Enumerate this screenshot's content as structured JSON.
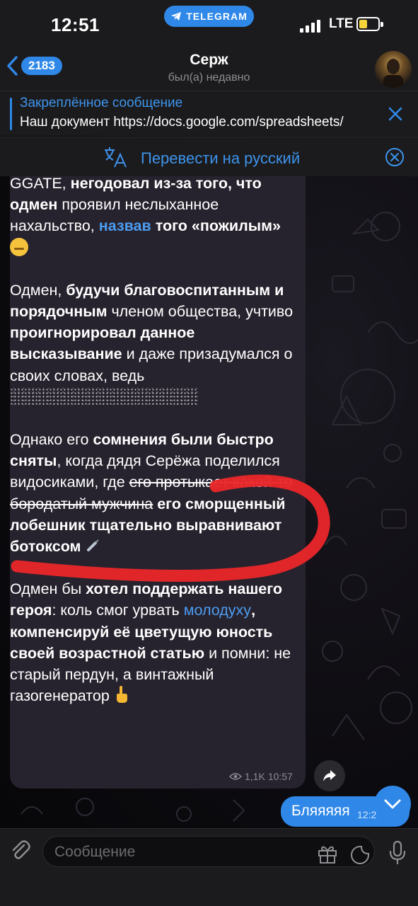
{
  "status_bar": {
    "time": "12:51",
    "app_pill": "TELEGRAM",
    "network": "LTE"
  },
  "header": {
    "back_count": "2183",
    "title": "Серж",
    "subtitle": "был(а) недавно"
  },
  "pinned": {
    "title": "Закреплённое сообщение",
    "text": "Наш документ https://docs.google.com/spreadsheets/"
  },
  "translate": {
    "label": "Перевести на русский"
  },
  "message": {
    "p1": {
      "a": "GGATE, ",
      "b": "негодовал из-за того, что одмен",
      "c": " проявил неслыханное нахальство, ",
      "link": "назвав",
      "d": " того «пожилым» "
    },
    "p2": {
      "a": "Одмен, ",
      "b": "будучи благовоспитанным и порядочным",
      "c": " членом общества, учтиво ",
      "d": "проигнорировал данное высказывание",
      "e": " и даже призадумался о своих словах, ведь "
    },
    "p3": {
      "a": "Однако его ",
      "b": "сомнения были быстро сняты",
      "c": ", когда дядя Серёжа поделился видосиками, где ",
      "strike": "его протыкает какой-то бородатый мужчина",
      "d": " его сморщенный лобешник тщательно выравнивают ботоксом "
    },
    "p4": {
      "a": "Одмен бы ",
      "b": "хотел поддержать нашего героя",
      "c": ": коль смог урвать ",
      "link": "молодуху",
      "d": ", компенсируй её цветущую юность своей возрастной статью",
      "e": " и помни: не старый пердун, а винтажный газогенератор "
    },
    "views": "1,1K",
    "time": "10:57",
    "emoji_pensive": "pensive-face",
    "emoji_syringe": "syringe",
    "emoji_hand": "index-pointing-up"
  },
  "outgoing": {
    "text": "Бляяяяя",
    "time": "12:2"
  },
  "input": {
    "placeholder": "Сообщение"
  },
  "colors": {
    "accent": "#2f88e8",
    "link": "#4b9bf0",
    "bubble": "#27232e",
    "annotation": "#e8262a"
  }
}
